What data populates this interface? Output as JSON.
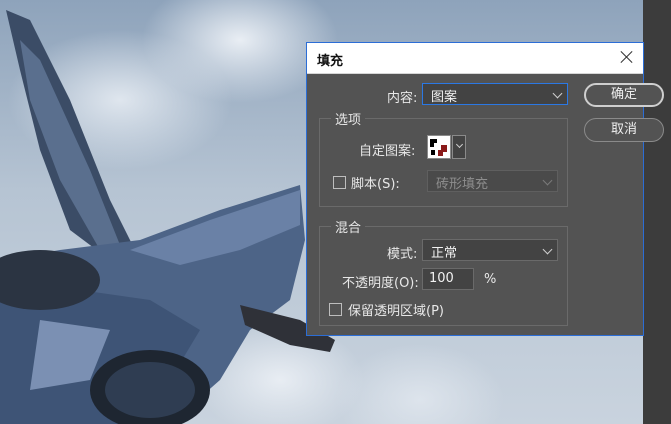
{
  "dialog": {
    "title": "填充",
    "content_label": "内容:",
    "content_value": "图案",
    "ok_label": "确定",
    "cancel_label": "取消",
    "options_group": {
      "title": "选项",
      "custom_pattern_label": "自定图案:",
      "script_label": "脚本(S):",
      "script_checked": false,
      "script_value": "砖形填充"
    },
    "blend_group": {
      "title": "混合",
      "mode_label": "模式:",
      "mode_value": "正常",
      "opacity_label": "不透明度(O):",
      "opacity_value": "100",
      "opacity_unit": "%",
      "preserve_label": "保留透明区域(P)",
      "preserve_checked": false
    }
  },
  "colors": {
    "dialog_bg": "#535353",
    "accent_border": "#2b6dd6",
    "text": "#e8e8e8"
  }
}
